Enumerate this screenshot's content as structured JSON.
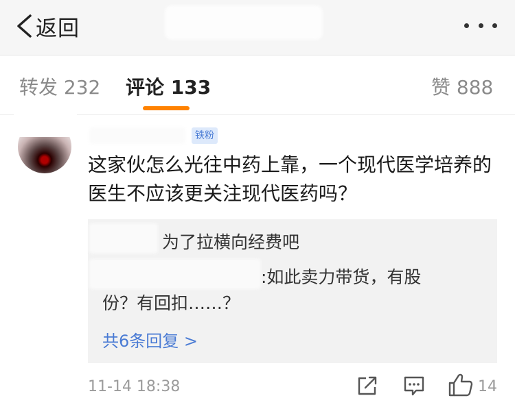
{
  "header": {
    "back_label": "返回"
  },
  "tabs": {
    "repost_label": "转发",
    "repost_count": "232",
    "comments_label": "评论",
    "comments_count": "133",
    "likes_label": "赞",
    "likes_count": "888"
  },
  "comment": {
    "badge": "铁粉",
    "text": "这家伙怎么光往中药上靠，一个现代医学培养的医生不应该更关注现代医药吗？",
    "replies": [
      {
        "text": "为了拉横向经费吧"
      },
      {
        "text_line1": ":如此卖力带货，有股",
        "text_line2": "份？有回扣……？"
      }
    ],
    "more_replies": "共6条回复 >",
    "time": "11-14 18:38",
    "like_count": "14"
  },
  "colors": {
    "accent": "#ff8200",
    "link": "#4a7bd4",
    "nav_bg": "#f6f6f6",
    "reply_bg": "#f2f2f2"
  },
  "icons": [
    "chevron-left-icon",
    "more-dots-icon",
    "share-icon",
    "comment-icon",
    "thumbs-up-icon"
  ]
}
